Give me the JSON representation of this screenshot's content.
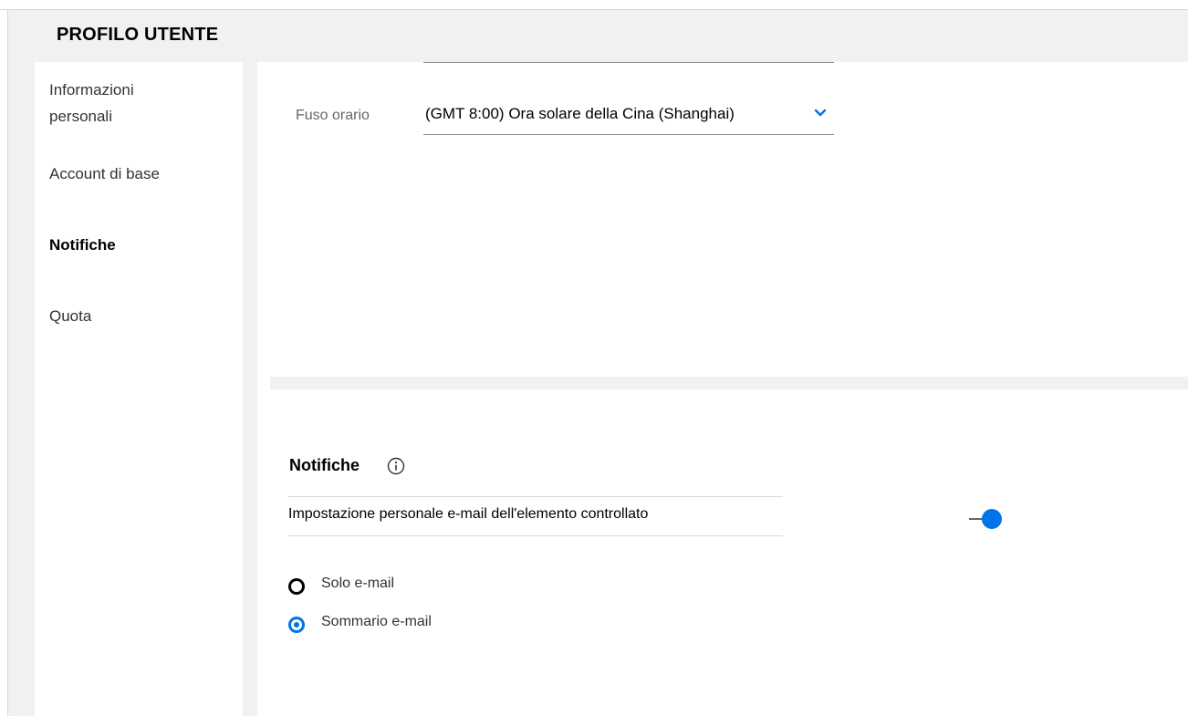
{
  "header": {
    "title": "PROFILO UTENTE"
  },
  "sidebar": {
    "items": [
      {
        "label_line1": "Informazioni",
        "label_line2": "personali"
      },
      {
        "label": "Account di base"
      },
      {
        "label": "Notifiche",
        "active": true
      },
      {
        "label": "Quota"
      }
    ]
  },
  "timezone": {
    "label": "Fuso orario",
    "value": "(GMT 8:00) Ora solare della Cina (Shanghai)",
    "icon": "chevron-down-icon"
  },
  "notifications": {
    "title": "Notifiche",
    "info_icon": "info-icon",
    "setting_label": "Impostazione personale e-mail dell'elemento controllato",
    "toggle_on": true,
    "options": [
      {
        "label": "Solo e-mail",
        "checked": false
      },
      {
        "label": "Sommario e-mail",
        "checked": true
      }
    ]
  },
  "colors": {
    "accent": "#0073e7",
    "header_bg": "#f1f1f1",
    "text": "#000000",
    "muted": "#666666"
  }
}
